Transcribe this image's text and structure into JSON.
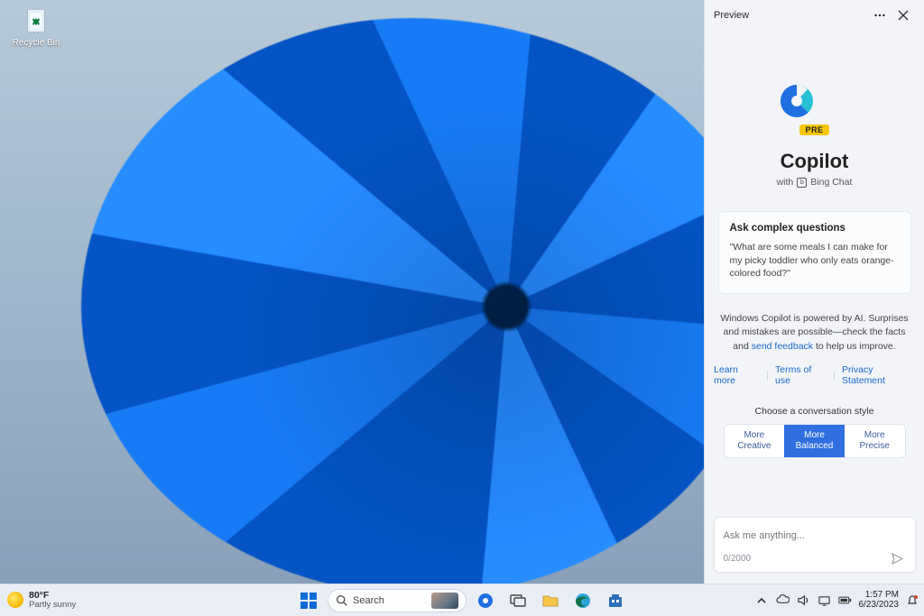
{
  "desktop": {
    "recycle_bin_label": "Recycle Bin"
  },
  "copilot": {
    "header_title": "Preview",
    "brand": "Copilot",
    "pre_badge": "PRE",
    "sub_prefix": "with",
    "sub_suffix": "Bing Chat",
    "bing_glyph": "b",
    "card_title": "Ask complex questions",
    "card_example": "\"What are some meals I can make for my picky toddler who only eats orange-colored food?\"",
    "disclaimer_pre": "Windows Copilot is powered by AI. Surprises and mistakes are possible—check the facts and ",
    "disclaimer_link": "send feedback",
    "disclaimer_post": " to help us improve.",
    "link_learn": "Learn more",
    "link_terms": "Terms of use",
    "link_privacy": "Privacy Statement",
    "style_title": "Choose a conversation style",
    "style_creative_l1": "More",
    "style_creative_l2": "Creative",
    "style_balanced_l1": "More",
    "style_balanced_l2": "Balanced",
    "style_precise_l1": "More",
    "style_precise_l2": "Precise",
    "input_placeholder": "Ask me anything...",
    "input_counter": "0/2000"
  },
  "taskbar": {
    "temp": "80°F",
    "condition": "Partly sunny",
    "search_label": "Search",
    "time": "1:57 PM",
    "date": "6/23/2023"
  }
}
